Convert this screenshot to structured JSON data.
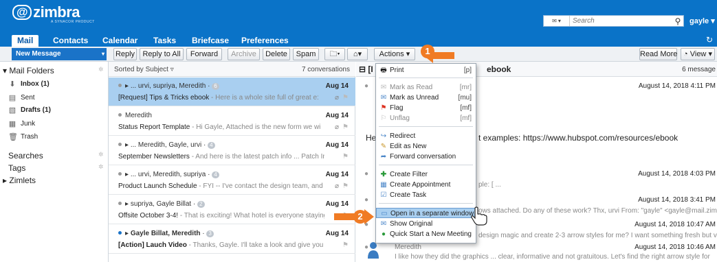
{
  "logo": {
    "name": "zimbra",
    "sub": "A SYNACOR PRODUCT"
  },
  "search": {
    "placeholder": "Search"
  },
  "user": {
    "name": "gayle"
  },
  "tabs": [
    {
      "label": "Mail",
      "active": true
    },
    {
      "label": "Contacts"
    },
    {
      "label": "Calendar"
    },
    {
      "label": "Tasks"
    },
    {
      "label": "Briefcase"
    },
    {
      "label": "Preferences"
    }
  ],
  "toolbar": {
    "new_message": "New Message",
    "reply": "Reply",
    "reply_all": "Reply to All",
    "forward": "Forward",
    "archive": "Archive",
    "delete": "Delete",
    "spam": "Spam",
    "actions": "Actions",
    "read_more": "Read More",
    "view": "View"
  },
  "sidebar": {
    "header": "Mail Folders",
    "folders": [
      {
        "label": "Inbox (1)",
        "bold": true,
        "icon": "inbox-icon"
      },
      {
        "label": "Sent",
        "icon": "sent-icon"
      },
      {
        "label": "Drafts (1)",
        "bold": true,
        "icon": "drafts-icon"
      },
      {
        "label": "Junk",
        "icon": "junk-icon"
      },
      {
        "label": "Trash",
        "icon": "trash-icon"
      }
    ],
    "searches": "Searches",
    "tags": "Tags",
    "zimlets": "Zimlets"
  },
  "list": {
    "sort": "Sorted by Subject",
    "count": "7 conversations",
    "items": [
      {
        "who": "... urvi, supriya, Meredith",
        "badge": "6",
        "date": "Aug 14",
        "subject": "[Request] Tips & Tricks ebook",
        "fragment": " - Here is a whole site full of great e:",
        "selected": true
      },
      {
        "who": "Meredith",
        "badge": "",
        "date": "Aug 14",
        "subject": "Status Report Template",
        "fragment": " - Hi Gayle, Attached is the new form we wi"
      },
      {
        "who": "... Meredith, Gayle, urvi",
        "badge": "4",
        "date": "Aug 14",
        "subject": "September Newsletters",
        "fragment": " - And here is the latest patch info ... Patch Info"
      },
      {
        "who": "... urvi, Meredith, supriya",
        "badge": "4",
        "date": "Aug 14",
        "subject": "Product Launch Schedule",
        "fragment": " - FYI -- I've contact the design team, and"
      },
      {
        "who": "supriya, Gayle Billat",
        "badge": "2",
        "date": "Aug 14",
        "subject": "Offsite October 3-4!",
        "fragment": " - That is exciting! What hotel is everyone staying i"
      },
      {
        "who": "Gayle Billat, Meredith",
        "badge": "3",
        "date": "Aug 14",
        "subject": "[Action] Lauch Video",
        "fragment": " - Thanks, Gayle. I'll take a look and give you feei"
      }
    ]
  },
  "reading": {
    "title_prefix": "[I",
    "title_suffix": "ebook",
    "count": "6 message",
    "date1": "August 14, 2018 4:11 PM",
    "body_left": "He",
    "body_right": "t examples: https://www.hubspot.com/resources/ebook",
    "date2": "August 14, 2018 4:03 PM",
    "frag2": "ple: [ ...",
    "date3": "August 14, 2018 3:41 PM",
    "frag3": "ows attached. Do any of these work? Thx, urvi From: \"gayle\" <gayle@mail.zimb",
    "date4": "August 14, 2018 10:47 AM",
    "frag4": "design magic and create 2-3 arrow styles for me? I want something fresh but ve",
    "sender5": "Meredith",
    "date5": "August 14, 2018 10:46 AM",
    "frag5": "I like how they did the graphics ... clear, informative and not gratuitous. Let's find the right arrow style for"
  },
  "menu": {
    "items": [
      {
        "label": "Print",
        "shortcut": "[p]",
        "icon": "print-icon"
      },
      {
        "label": "Mark as Read",
        "shortcut": "[mr]",
        "disabled": true,
        "icon": "mark-read-icon"
      },
      {
        "label": "Mark as Unread",
        "shortcut": "[mu]",
        "icon": "mark-unread-icon"
      },
      {
        "label": "Flag",
        "shortcut": "[mf]",
        "icon": "flag-icon"
      },
      {
        "label": "Unflag",
        "shortcut": "[mf]",
        "disabled": true,
        "icon": "unflag-icon"
      },
      {
        "label": "Redirect",
        "shortcut": "",
        "icon": "redirect-icon"
      },
      {
        "label": "Edit as New",
        "shortcut": "",
        "icon": "edit-icon"
      },
      {
        "label": "Forward conversation",
        "shortcut": "",
        "icon": "forward-icon"
      },
      {
        "label": "Create Filter",
        "shortcut": "",
        "icon": "filter-icon"
      },
      {
        "label": "Create Appointment",
        "shortcut": "",
        "icon": "appointment-icon"
      },
      {
        "label": "Create Task",
        "shortcut": "",
        "icon": "task-icon"
      },
      {
        "label": "Open in a separate window",
        "shortcut": "",
        "icon": "window-icon",
        "highlight": true
      },
      {
        "label": "Show Original",
        "shortcut": "",
        "icon": "original-icon"
      },
      {
        "label": "Quick Start a New Meeting",
        "shortcut": "",
        "icon": "meeting-icon"
      }
    ]
  },
  "callouts": {
    "one": "1",
    "two": "2"
  },
  "colors": {
    "brand": "#0a73c8",
    "selected": "#a9cff0",
    "callout": "#f07b24"
  }
}
